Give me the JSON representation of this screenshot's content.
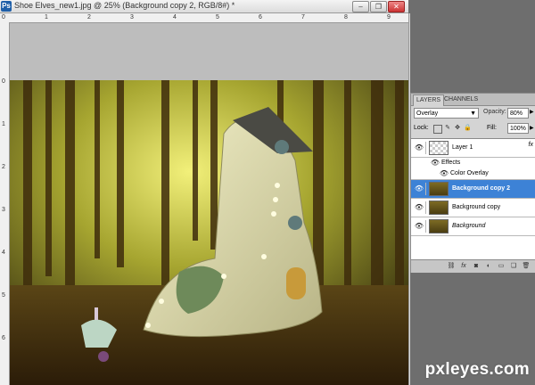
{
  "window": {
    "app_icon": "Ps",
    "title": "Shoe Elves_new1.jpg @ 25% (Background copy 2, RGB/8#) *",
    "buttons": [
      "minimize",
      "restore",
      "close"
    ]
  },
  "rulers": {
    "horizontal": [
      "0",
      "1",
      "2",
      "3",
      "4",
      "5",
      "6",
      "7",
      "8",
      "9"
    ],
    "vertical": [
      "0",
      "1",
      "2",
      "3",
      "4",
      "5",
      "6"
    ]
  },
  "layers_panel": {
    "tabs": [
      "LAYERS",
      "CHANNELS"
    ],
    "blend_mode": "Overlay",
    "opacity_label": "Opacity:",
    "opacity": "80%",
    "lock_label": "Lock:",
    "fill_label": "Fill:",
    "fill": "100%",
    "layers": [
      {
        "name": "Layer 1",
        "thumb": "transparent",
        "fx": true
      },
      {
        "name": "Effects",
        "type": "sub"
      },
      {
        "name": "Color Overlay",
        "type": "sub2"
      },
      {
        "name": "Background copy 2",
        "selected": true
      },
      {
        "name": "Background copy"
      },
      {
        "name": "Background",
        "italic": true
      }
    ],
    "fx_symbol": "fx"
  },
  "watermark": "pxleyes.com",
  "colors": {
    "selection": "#3d82d6",
    "panel": "#d4d4d4",
    "background": "#6e6e6e"
  }
}
